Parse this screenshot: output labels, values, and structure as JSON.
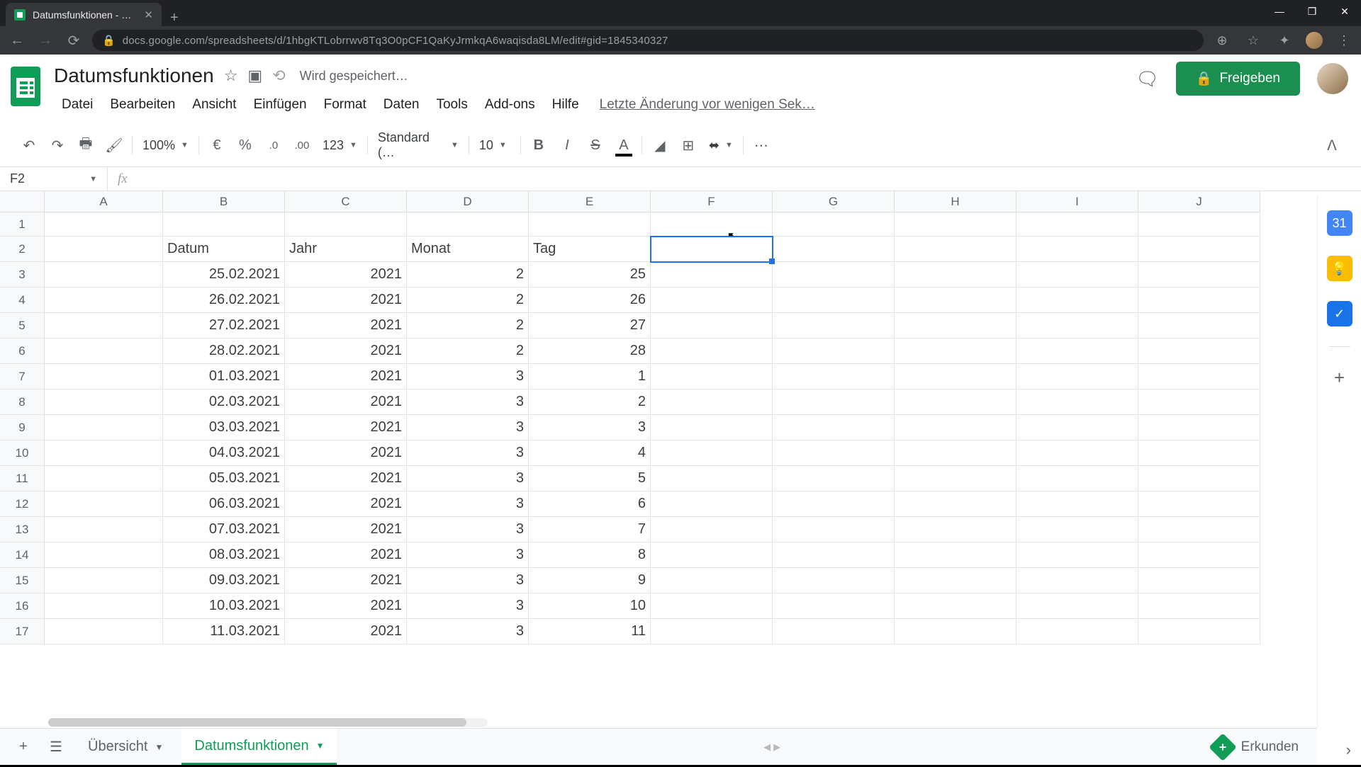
{
  "browser": {
    "tab_title": "Datumsfunktionen - Google Tab",
    "url": "docs.google.com/spreadsheets/d/1hbgKTLobrrwv8Tq3O0pCF1QaKyJrmkqA6waqisda8LM/edit#gid=1845340327"
  },
  "doc": {
    "title": "Datumsfunktionen",
    "saving_text": "Wird gespeichert…",
    "last_change": "Letzte Änderung vor wenigen Sek…"
  },
  "menu": {
    "file": "Datei",
    "edit": "Bearbeiten",
    "view": "Ansicht",
    "insert": "Einfügen",
    "format": "Format",
    "data": "Daten",
    "tools": "Tools",
    "addons": "Add-ons",
    "help": "Hilfe"
  },
  "share": {
    "label": "Freigeben"
  },
  "toolbar": {
    "zoom": "100%",
    "format_123": "123",
    "font": "Standard (…",
    "font_size": "10",
    "decrease_dec": ".0",
    "increase_dec": ".00",
    "currency": "€",
    "percent": "%"
  },
  "formula_bar": {
    "cell_ref": "F2",
    "value": ""
  },
  "columns": [
    "A",
    "B",
    "C",
    "D",
    "E",
    "F",
    "G",
    "H",
    "I",
    "J"
  ],
  "headers": {
    "B": "Datum",
    "C": "Jahr",
    "D": "Monat",
    "E": "Tag"
  },
  "rows": [
    {
      "n": 1
    },
    {
      "n": 2
    },
    {
      "n": 3,
      "B": "25.02.2021",
      "C": "2021",
      "D": "2",
      "E": "25"
    },
    {
      "n": 4,
      "B": "26.02.2021",
      "C": "2021",
      "D": "2",
      "E": "26"
    },
    {
      "n": 5,
      "B": "27.02.2021",
      "C": "2021",
      "D": "2",
      "E": "27"
    },
    {
      "n": 6,
      "B": "28.02.2021",
      "C": "2021",
      "D": "2",
      "E": "28"
    },
    {
      "n": 7,
      "B": "01.03.2021",
      "C": "2021",
      "D": "3",
      "E": "1"
    },
    {
      "n": 8,
      "B": "02.03.2021",
      "C": "2021",
      "D": "3",
      "E": "2"
    },
    {
      "n": 9,
      "B": "03.03.2021",
      "C": "2021",
      "D": "3",
      "E": "3"
    },
    {
      "n": 10,
      "B": "04.03.2021",
      "C": "2021",
      "D": "3",
      "E": "4"
    },
    {
      "n": 11,
      "B": "05.03.2021",
      "C": "2021",
      "D": "3",
      "E": "5"
    },
    {
      "n": 12,
      "B": "06.03.2021",
      "C": "2021",
      "D": "3",
      "E": "6"
    },
    {
      "n": 13,
      "B": "07.03.2021",
      "C": "2021",
      "D": "3",
      "E": "7"
    },
    {
      "n": 14,
      "B": "08.03.2021",
      "C": "2021",
      "D": "3",
      "E": "8"
    },
    {
      "n": 15,
      "B": "09.03.2021",
      "C": "2021",
      "D": "3",
      "E": "9"
    },
    {
      "n": 16,
      "B": "10.03.2021",
      "C": "2021",
      "D": "3",
      "E": "10"
    },
    {
      "n": 17,
      "B": "11.03.2021",
      "C": "2021",
      "D": "3",
      "E": "11"
    }
  ],
  "selected_cell": "F2",
  "sheet_tabs": {
    "overview": "Übersicht",
    "active": "Datumsfunktionen"
  },
  "explore": "Erkunden"
}
